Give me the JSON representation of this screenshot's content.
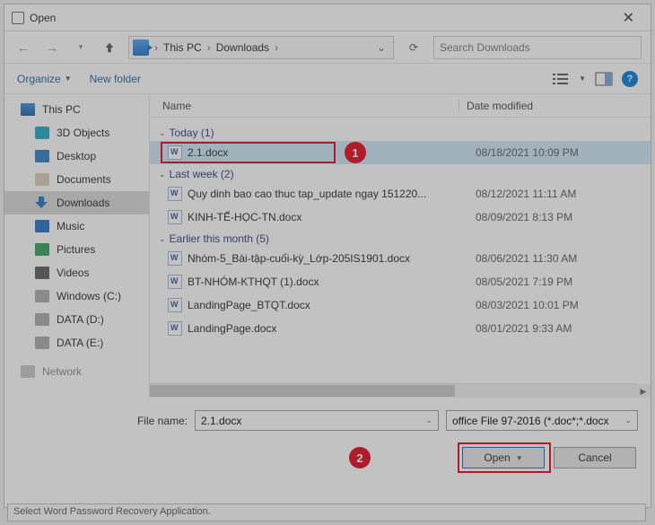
{
  "window": {
    "title": "Open"
  },
  "nav": {
    "crumbs": [
      "This PC",
      "Downloads"
    ],
    "search_placeholder": "Search Downloads"
  },
  "toolbar": {
    "organize": "Organize",
    "new_folder": "New folder"
  },
  "sidebar": {
    "items": [
      {
        "label": "This PC",
        "icon": "pc"
      },
      {
        "label": "3D Objects",
        "icon": "3d"
      },
      {
        "label": "Desktop",
        "icon": "desk"
      },
      {
        "label": "Documents",
        "icon": "doc"
      },
      {
        "label": "Downloads",
        "icon": "down",
        "selected": true
      },
      {
        "label": "Music",
        "icon": "music"
      },
      {
        "label": "Pictures",
        "icon": "pic"
      },
      {
        "label": "Videos",
        "icon": "vid"
      },
      {
        "label": "Windows (C:)",
        "icon": "drv"
      },
      {
        "label": "DATA (D:)",
        "icon": "drv"
      },
      {
        "label": "DATA (E:)",
        "icon": "drv"
      },
      {
        "label": "Network",
        "icon": "net",
        "dim": true
      }
    ]
  },
  "columns": {
    "name": "Name",
    "date": "Date modified"
  },
  "groups": [
    {
      "title": "Today (1)",
      "rows": [
        {
          "name": "2.1.docx",
          "date": "08/18/2021 10:09 PM",
          "selected": true
        }
      ]
    },
    {
      "title": "Last week (2)",
      "rows": [
        {
          "name": "Quy dinh bao cao thuc tap_update ngay 151220...",
          "date": "08/12/2021 11:11 AM"
        },
        {
          "name": "KINH-TẾ-HỌC-TN.docx",
          "date": "08/09/2021 8:13 PM"
        }
      ]
    },
    {
      "title": "Earlier this month (5)",
      "rows": [
        {
          "name": "Nhóm-5_Bài-tập-cuối-kỳ_Lớp-205IS1901.docx",
          "date": "08/06/2021 11:30 AM"
        },
        {
          "name": "BT-NHÓM-KTHQT (1).docx",
          "date": "08/05/2021 7:19 PM"
        },
        {
          "name": "LandingPage_BTQT.docx",
          "date": "08/03/2021 10:01 PM"
        },
        {
          "name": "LandingPage.docx",
          "date": "08/01/2021 9:33 AM"
        }
      ]
    }
  ],
  "filename": {
    "label": "File name:",
    "value": "2.1.docx"
  },
  "filetype": {
    "value": "office File 97-2016 (*.doc*;*.docx"
  },
  "buttons": {
    "open": "Open",
    "cancel": "Cancel"
  },
  "callouts": {
    "c1": "1",
    "c2": "2"
  },
  "footer": "Select Word Password Recovery Application."
}
